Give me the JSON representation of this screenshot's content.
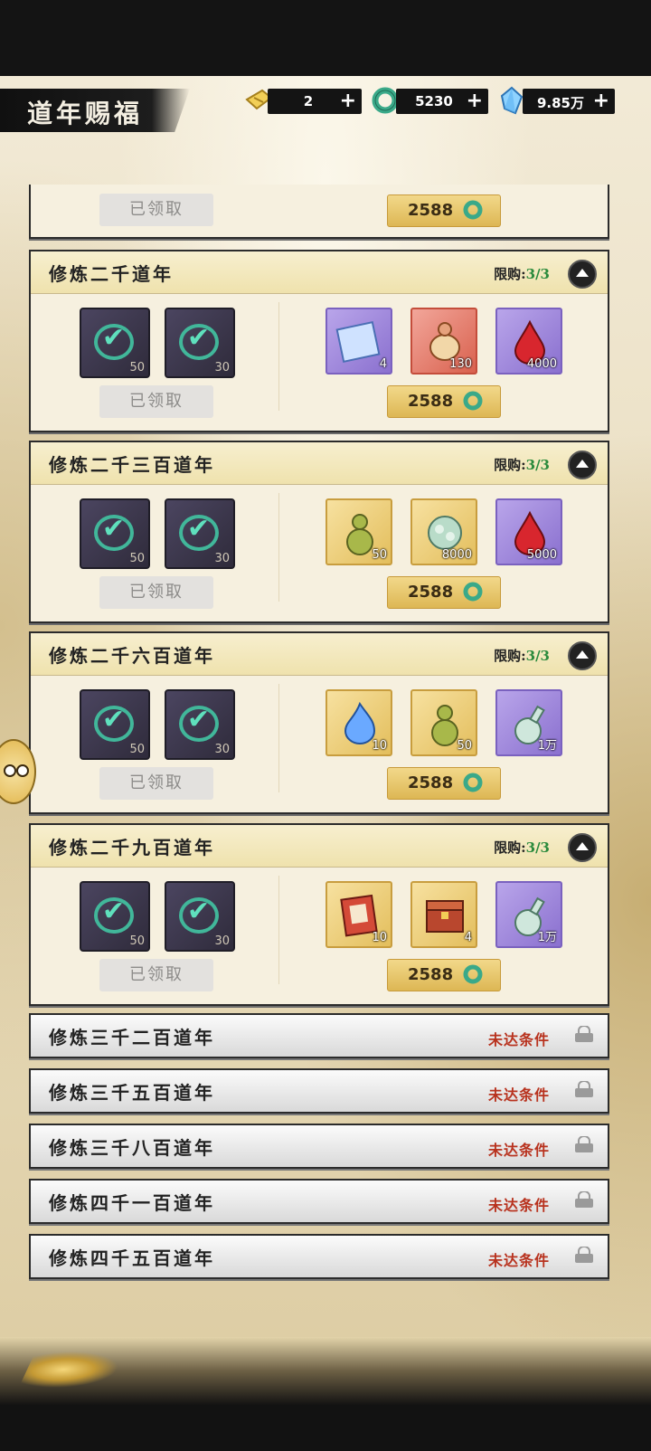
{
  "header": {
    "title": "道年赐福",
    "currencies": [
      {
        "icon": "gold-ticket-icon",
        "value": "2"
      },
      {
        "icon": "jade-ring-icon",
        "value": "5230"
      },
      {
        "icon": "spirit-crystal-icon",
        "value": "9.85万"
      }
    ],
    "add_label": "+"
  },
  "top_partial": {
    "status": "已领取",
    "price": "2588"
  },
  "tiers": [
    {
      "name": "修炼二千道年",
      "limit_label": "限购:",
      "limit_value": "3/3",
      "claimed": [
        {
          "qty": "50"
        },
        {
          "qty": "30"
        }
      ],
      "status": "已领取",
      "rewards": [
        {
          "icon": "scroll-icon",
          "color": "purple",
          "qty": "4"
        },
        {
          "icon": "gourd-flask-icon",
          "color": "red",
          "qty": "130"
        },
        {
          "icon": "blood-drop-icon",
          "color": "purple",
          "qty": "4000"
        }
      ],
      "price": "2588"
    },
    {
      "name": "修炼二千三百道年",
      "limit_label": "限购:",
      "limit_value": "3/3",
      "claimed": [
        {
          "qty": "50"
        },
        {
          "qty": "30"
        }
      ],
      "status": "已领取",
      "rewards": [
        {
          "icon": "gourd-icon",
          "color": "gold",
          "qty": "50"
        },
        {
          "icon": "spirit-herb-icon",
          "color": "gold",
          "qty": "8000"
        },
        {
          "icon": "blood-drop-icon",
          "color": "purple",
          "qty": "5000"
        }
      ],
      "price": "2588"
    },
    {
      "name": "修炼二千六百道年",
      "limit_label": "限购:",
      "limit_value": "3/3",
      "claimed": [
        {
          "qty": "50"
        },
        {
          "qty": "30"
        }
      ],
      "status": "已领取",
      "rewards": [
        {
          "icon": "blue-flame-icon",
          "color": "gold",
          "qty": "10"
        },
        {
          "icon": "gourd-icon",
          "color": "gold",
          "qty": "50"
        },
        {
          "icon": "elixir-flask-icon",
          "color": "purple",
          "qty": "1万"
        }
      ],
      "price": "2588"
    },
    {
      "name": "修炼二千九百道年",
      "limit_label": "限购:",
      "limit_value": "3/3",
      "claimed": [
        {
          "qty": "50"
        },
        {
          "qty": "30"
        }
      ],
      "status": "已领取",
      "rewards": [
        {
          "icon": "red-book-icon",
          "color": "gold",
          "qty": "10"
        },
        {
          "icon": "treasure-chest-icon",
          "color": "gold",
          "qty": "4"
        },
        {
          "icon": "elixir-flask-icon",
          "color": "purple",
          "qty": "1万"
        }
      ],
      "price": "2588"
    }
  ],
  "locked_tiers": [
    {
      "name": "修炼三千二百道年",
      "status": "未达条件"
    },
    {
      "name": "修炼三千五百道年",
      "status": "未达条件"
    },
    {
      "name": "修炼三千八百道年",
      "status": "未达条件"
    },
    {
      "name": "修炼四千一百道年",
      "status": "未达条件"
    },
    {
      "name": "修炼四千五百道年",
      "status": "未达条件"
    }
  ]
}
